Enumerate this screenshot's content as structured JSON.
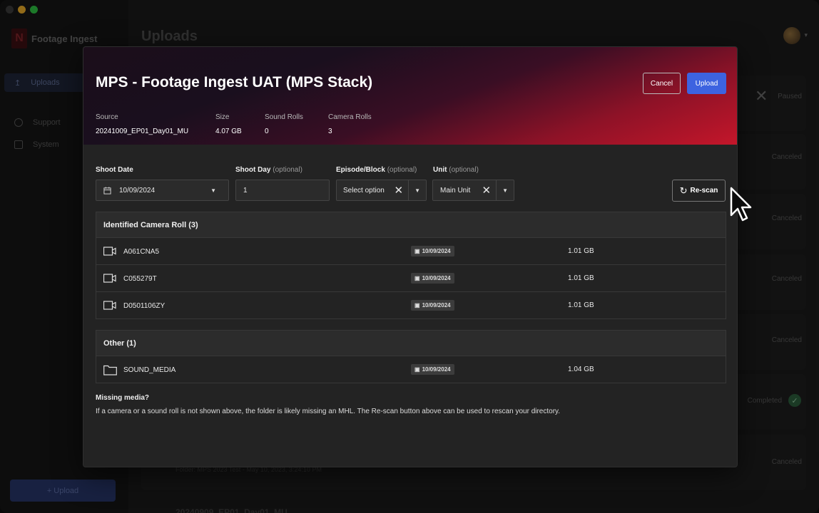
{
  "app": {
    "brand": "Footage Ingest",
    "page_title": "Uploads",
    "sidebar": {
      "items": [
        {
          "label": "Uploads"
        },
        {
          "label": "Support"
        },
        {
          "label": "System"
        }
      ],
      "upload_button": "+ Upload"
    },
    "background_statuses": [
      "Paused",
      "Canceled",
      "Canceled",
      "Canceled",
      "Canceled",
      "Completed",
      "Canceled"
    ],
    "background_folder_text": "Folder: MPS 2023 Test - May 10, 2023, 3:24:10 PM",
    "background_bottom_title": "20240909_EP01_Day01_MU"
  },
  "modal": {
    "title": "MPS - Footage Ingest UAT (MPS Stack)",
    "cancel_label": "Cancel",
    "upload_label": "Upload",
    "meta": {
      "source_label": "Source",
      "source_value": "20241009_EP01_Day01_MU",
      "size_label": "Size",
      "size_value": "4.07 GB",
      "sound_label": "Sound Rolls",
      "sound_value": "0",
      "camera_label": "Camera Rolls",
      "camera_value": "3"
    },
    "fields": {
      "shoot_date_label": "Shoot Date",
      "shoot_date_value": "10/09/2024",
      "shoot_day_label": "Shoot Day",
      "shoot_day_value": "1",
      "episode_label": "Episode/Block",
      "episode_value": "Select option",
      "unit_label": "Unit",
      "unit_value": "Main Unit",
      "optional": "(optional)"
    },
    "rescan_label": "Re-scan",
    "camera_section": {
      "title": "Identified Camera Roll (3)",
      "rows": [
        {
          "name": "A061CNA5",
          "date": "10/09/2024",
          "size": "1.01 GB"
        },
        {
          "name": "C055279T",
          "date": "10/09/2024",
          "size": "1.01 GB"
        },
        {
          "name": "D0501106ZY",
          "date": "10/09/2024",
          "size": "1.01 GB"
        }
      ]
    },
    "other_section": {
      "title": "Other (1)",
      "rows": [
        {
          "name": "SOUND_MEDIA",
          "date": "10/09/2024",
          "size": "1.04 GB"
        }
      ]
    },
    "missing": {
      "title": "Missing media?",
      "text": "If a camera or a sound roll is not shown above, the folder is likely missing an MHL. The Re-scan button above can be used to rescan your directory."
    }
  }
}
